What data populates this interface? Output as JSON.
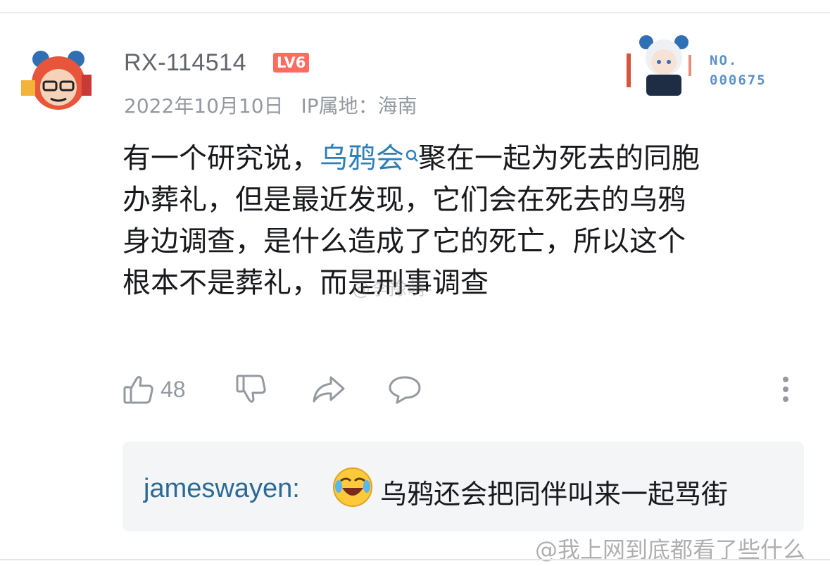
{
  "comment": {
    "username": "RX-114514",
    "level": "LV6",
    "date": "2022年10月10日",
    "ip_location": "IP属地：海南",
    "fan_badge_label": "NO.",
    "fan_badge_number": "000675",
    "body_lines": [
      {
        "before": "有一个研究说，",
        "link": "乌鸦会",
        "after": "聚在一起为死去的同胞"
      },
      {
        "text": "办葬礼，但是最近发现，它们会在死去的乌鸦"
      },
      {
        "text": "身边调查，是什么造成了它的死亡，所以这个"
      },
      {
        "text": "根本不是葬礼，而是刑事调查"
      }
    ],
    "like_count": "48"
  },
  "reply": {
    "username": "jameswayen:",
    "text": "乌鸦还会把同伴叫来一起骂街"
  },
  "icons": {
    "like": "thumbs-up-icon",
    "dislike": "thumbs-down-icon",
    "share": "share-icon",
    "comment": "comment-bubble-icon",
    "more": "more-vertical-icon",
    "emoji": "laughing-crying-emoji-icon"
  },
  "colors": {
    "link": "#2d7fb8",
    "level_badge": "#ff6b5e",
    "reply_user": "#2b6a97",
    "meta_text": "#9499a0"
  },
  "watermarks": {
    "middle": "@李豫萌-",
    "bottom": "@我上网到底都看了些什么"
  }
}
